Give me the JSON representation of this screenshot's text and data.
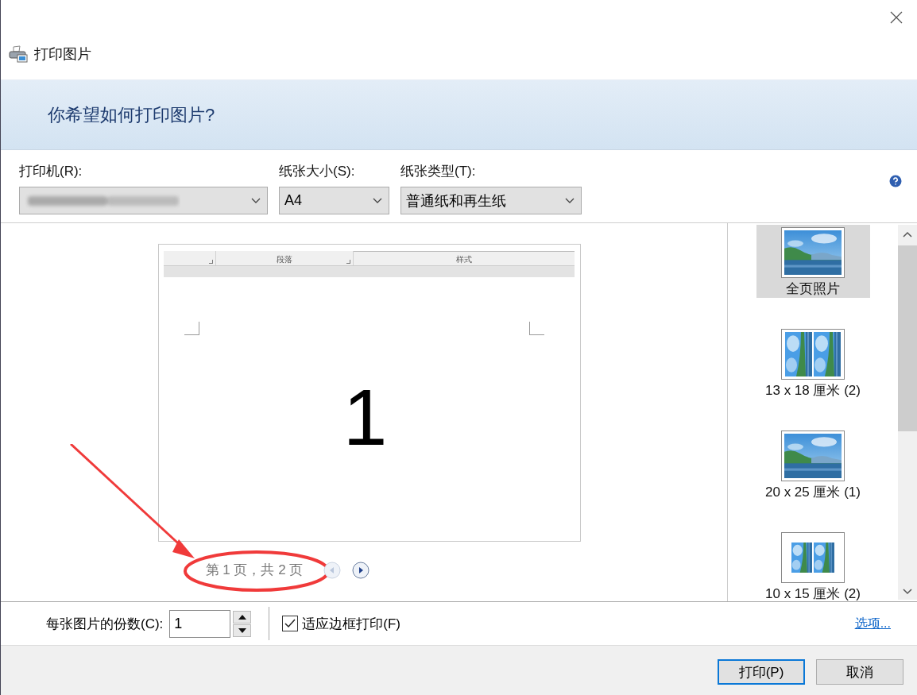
{
  "window": {
    "title": "打印图片"
  },
  "heading": "你希望如何打印图片?",
  "dropdowns": [
    {
      "label": "打印机(R):",
      "kind": "redacted"
    },
    {
      "label": "纸张大小(S):",
      "kind": "text",
      "value": "A4"
    },
    {
      "label": "纸张类型(T):",
      "kind": "text",
      "value": "普通纸和再生纸"
    }
  ],
  "preview": {
    "ribbon": [
      "段落",
      "样式"
    ],
    "page_number": "1",
    "pager": "第 1 页，共 2 页",
    "prev_disabled": true,
    "next_disabled": false
  },
  "layouts": [
    {
      "label": "全页照片",
      "selected": true,
      "kind": "single"
    },
    {
      "label": "13 x 18 厘米 (2)",
      "selected": false,
      "kind": "double"
    },
    {
      "label": "20 x 25 厘米 (1)",
      "selected": false,
      "kind": "single"
    },
    {
      "label": "10 x 15 厘米 (2)",
      "selected": false,
      "kind": "double-small"
    }
  ],
  "copies": {
    "label": "每张图片的份数(C):",
    "value": "1"
  },
  "fit": {
    "label": "适应边框打印(F)",
    "checked": true
  },
  "options_link": "选项...",
  "buttons": [
    {
      "label": "打印(P)",
      "default": true
    },
    {
      "label": "取消",
      "default": false
    }
  ]
}
